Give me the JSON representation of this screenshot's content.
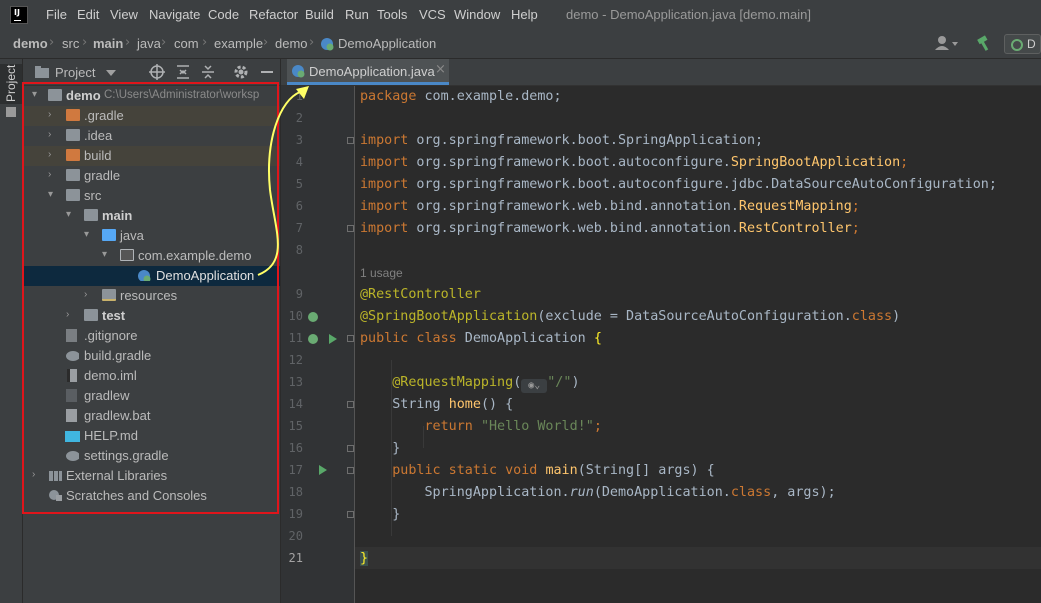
{
  "menubar": {
    "logo_text": "IJ",
    "items": [
      "File",
      "Edit",
      "View",
      "Navigate",
      "Code",
      "Refactor",
      "Build",
      "Run",
      "Tools",
      "VCS",
      "Window",
      "Help"
    ],
    "window_title": "demo - DemoApplication.java [demo.main]"
  },
  "breadcrumbs": [
    "demo",
    "src",
    "main",
    "java",
    "com",
    "example",
    "demo",
    "DemoApplication"
  ],
  "toolbar": {
    "run_config_label": "D"
  },
  "side_strip": {
    "tab_label": "Project"
  },
  "project_panel": {
    "title": "Project",
    "root": {
      "name": "demo",
      "path": "C:\\Users\\Administrator\\worksp"
    },
    "items": [
      {
        "label": ".gradle"
      },
      {
        "label": ".idea"
      },
      {
        "label": "build"
      },
      {
        "label": "gradle"
      },
      {
        "label": "src"
      },
      {
        "label": "main"
      },
      {
        "label": "java"
      },
      {
        "label": "com.example.demo"
      },
      {
        "label": "DemoApplication"
      },
      {
        "label": "resources"
      },
      {
        "label": "test"
      },
      {
        "label": ".gitignore"
      },
      {
        "label": "build.gradle"
      },
      {
        "label": "demo.iml"
      },
      {
        "label": "gradlew"
      },
      {
        "label": "gradlew.bat"
      },
      {
        "label": "HELP.md"
      },
      {
        "label": "settings.gradle"
      },
      {
        "label": "External Libraries"
      },
      {
        "label": "Scratches and Consoles"
      }
    ]
  },
  "editor": {
    "tab_label": "DemoApplication.java",
    "usage_hint": "1 usage",
    "line_numbers": [
      "1",
      "2",
      "3",
      "4",
      "5",
      "6",
      "7",
      "8",
      "9",
      "10",
      "11",
      "12",
      "13",
      "14",
      "15",
      "16",
      "17",
      "18",
      "19",
      "20",
      "21"
    ],
    "code": {
      "l1a": "package",
      "l1b": " com.example.demo;",
      "import_kw": "import",
      "l3b": " org.springframework.boot.SpringApplication;",
      "l4b": " org.springframework.boot.autoconfigure.",
      "l4c": "SpringBootApplication",
      "l4d": ";",
      "l5b": " org.springframework.boot.autoconfigure.jdbc.DataSourceAutoConfiguration;",
      "l6b": " org.springframework.web.bind.annotation.",
      "l6c": "RequestMapping",
      "l6d": ";",
      "l7b": " org.springframework.web.bind.annotation.",
      "l7c": "RestController",
      "l7d": ";",
      "l9": "@RestController",
      "l10a": "@SpringBootApplication",
      "l10b": "(exclude = DataSourceAutoConfiguration.",
      "l10c": "class",
      "l10d": ")",
      "l11a": "public class",
      "l11b": " DemoApplication ",
      "l11c": "{",
      "l13a": "@RequestMapping",
      "l13b": "(",
      "l13c": "\"/\"",
      "l13d": ")",
      "l14a": "String ",
      "l14b": "home",
      "l14c": "() {",
      "l15a": "return ",
      "l15b": "\"Hello World!\"",
      "l15c": ";",
      "l16": "}",
      "l17a": "public static void ",
      "l17b": "main",
      "l17c": "(String[] args) {",
      "l18a": "SpringApplication.",
      "l18b": "run",
      "l18c": "(DemoApplication.",
      "l18d": "class",
      "l18e": ", args);",
      "l19": "}",
      "l21": "}"
    }
  },
  "colors": {
    "selection": "#0d293e",
    "highlight_box": "#e0151b",
    "arrow": "#ffff66",
    "accent_tab": "#4a88c7"
  }
}
